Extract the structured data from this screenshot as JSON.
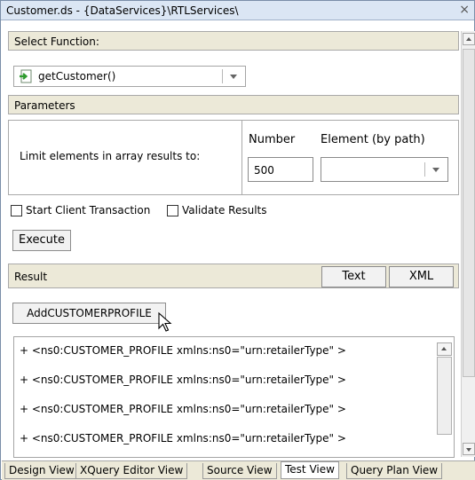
{
  "window": {
    "title": "Customer.ds - {DataServices}\\RTLServices\\",
    "close_glyph": "×"
  },
  "select_function": {
    "header": "Select Function:",
    "selected": "getCustomer()",
    "icon": "function-arrow-icon"
  },
  "parameters": {
    "header": "Parameters",
    "limit_label": "Limit elements in array results to:",
    "number_label": "Number",
    "element_label": "Element (by path)",
    "number_value": "500",
    "element_value": ""
  },
  "options": {
    "start_client_transaction": "Start Client Transaction",
    "validate_results": "Validate Results",
    "start_checked": false,
    "validate_checked": false
  },
  "execute_label": "Execute",
  "result": {
    "header": "Result",
    "text_button": "Text",
    "xml_button": "XML",
    "add_button": "AddCUSTOMERPROFILE",
    "rows": [
      "+ <ns0:CUSTOMER_PROFILE xmlns:ns0=\"urn:retailerType\" >",
      "+ <ns0:CUSTOMER_PROFILE xmlns:ns0=\"urn:retailerType\" >",
      "+ <ns0:CUSTOMER_PROFILE xmlns:ns0=\"urn:retailerType\" >",
      "+ <ns0:CUSTOMER_PROFILE xmlns:ns0=\"urn:retailerType\" >"
    ]
  },
  "tabs": [
    {
      "label": "Design View",
      "active": false
    },
    {
      "label": "XQuery Editor View",
      "active": false
    },
    {
      "label": "Source View",
      "active": false
    },
    {
      "label": "Test View",
      "active": true
    },
    {
      "label": "Query Plan View",
      "active": false
    }
  ],
  "colors": {
    "section_bg": "#ece9d8",
    "title_bg": "#dbe6f4",
    "icon_green": "#2e9b2e"
  }
}
